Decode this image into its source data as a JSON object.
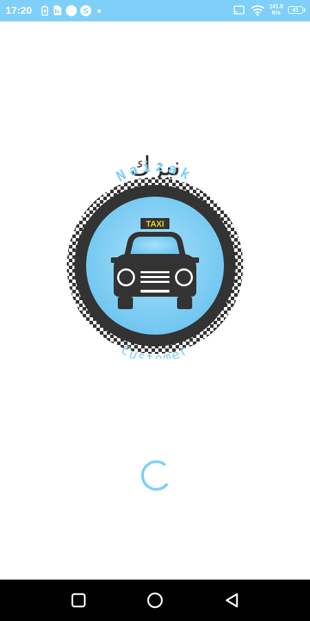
{
  "status_bar": {
    "time": "17:20",
    "net_speed_value": "141.8",
    "net_speed_unit": "K/s",
    "battery_level": "41",
    "background_color": "#7fd0f8",
    "icons": [
      "battery-saver-icon",
      "sim-icon",
      "circle-notification-icon",
      "s-app-icon",
      "dot-icon",
      "cast-icon",
      "wifi-icon"
    ]
  },
  "logo": {
    "arabic_text": "نيزك",
    "brand_text": "Naizak",
    "subtitle_text": "Customer",
    "taxi_sign": "TAXI",
    "circle_color": "#7fd0f8",
    "ring_color": "#333333",
    "sign_color": "#f2d21b"
  },
  "loading": {
    "spinner_color": "#7fd0f8"
  },
  "nav_bar": {
    "buttons": [
      "recents-icon",
      "home-icon",
      "back-icon"
    ]
  }
}
